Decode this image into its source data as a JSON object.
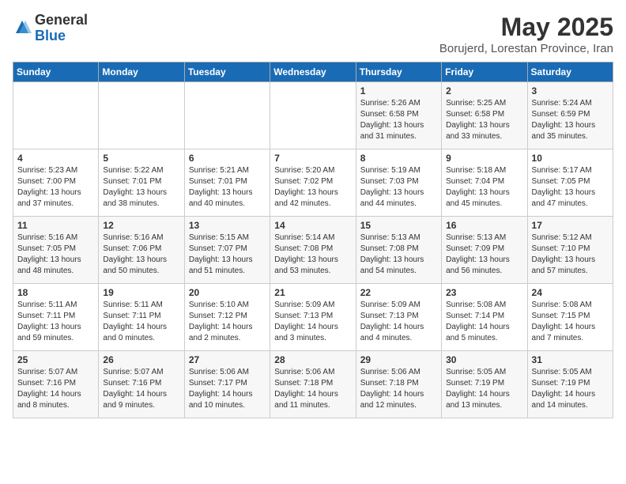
{
  "logo": {
    "general": "General",
    "blue": "Blue"
  },
  "title": {
    "month_year": "May 2025",
    "location": "Borujerd, Lorestan Province, Iran"
  },
  "days_of_week": [
    "Sunday",
    "Monday",
    "Tuesday",
    "Wednesday",
    "Thursday",
    "Friday",
    "Saturday"
  ],
  "weeks": [
    [
      {
        "day": "",
        "info": ""
      },
      {
        "day": "",
        "info": ""
      },
      {
        "day": "",
        "info": ""
      },
      {
        "day": "",
        "info": ""
      },
      {
        "day": "1",
        "info": "Sunrise: 5:26 AM\nSunset: 6:58 PM\nDaylight: 13 hours\nand 31 minutes."
      },
      {
        "day": "2",
        "info": "Sunrise: 5:25 AM\nSunset: 6:58 PM\nDaylight: 13 hours\nand 33 minutes."
      },
      {
        "day": "3",
        "info": "Sunrise: 5:24 AM\nSunset: 6:59 PM\nDaylight: 13 hours\nand 35 minutes."
      }
    ],
    [
      {
        "day": "4",
        "info": "Sunrise: 5:23 AM\nSunset: 7:00 PM\nDaylight: 13 hours\nand 37 minutes."
      },
      {
        "day": "5",
        "info": "Sunrise: 5:22 AM\nSunset: 7:01 PM\nDaylight: 13 hours\nand 38 minutes."
      },
      {
        "day": "6",
        "info": "Sunrise: 5:21 AM\nSunset: 7:01 PM\nDaylight: 13 hours\nand 40 minutes."
      },
      {
        "day": "7",
        "info": "Sunrise: 5:20 AM\nSunset: 7:02 PM\nDaylight: 13 hours\nand 42 minutes."
      },
      {
        "day": "8",
        "info": "Sunrise: 5:19 AM\nSunset: 7:03 PM\nDaylight: 13 hours\nand 44 minutes."
      },
      {
        "day": "9",
        "info": "Sunrise: 5:18 AM\nSunset: 7:04 PM\nDaylight: 13 hours\nand 45 minutes."
      },
      {
        "day": "10",
        "info": "Sunrise: 5:17 AM\nSunset: 7:05 PM\nDaylight: 13 hours\nand 47 minutes."
      }
    ],
    [
      {
        "day": "11",
        "info": "Sunrise: 5:16 AM\nSunset: 7:05 PM\nDaylight: 13 hours\nand 48 minutes."
      },
      {
        "day": "12",
        "info": "Sunrise: 5:16 AM\nSunset: 7:06 PM\nDaylight: 13 hours\nand 50 minutes."
      },
      {
        "day": "13",
        "info": "Sunrise: 5:15 AM\nSunset: 7:07 PM\nDaylight: 13 hours\nand 51 minutes."
      },
      {
        "day": "14",
        "info": "Sunrise: 5:14 AM\nSunset: 7:08 PM\nDaylight: 13 hours\nand 53 minutes."
      },
      {
        "day": "15",
        "info": "Sunrise: 5:13 AM\nSunset: 7:08 PM\nDaylight: 13 hours\nand 54 minutes."
      },
      {
        "day": "16",
        "info": "Sunrise: 5:13 AM\nSunset: 7:09 PM\nDaylight: 13 hours\nand 56 minutes."
      },
      {
        "day": "17",
        "info": "Sunrise: 5:12 AM\nSunset: 7:10 PM\nDaylight: 13 hours\nand 57 minutes."
      }
    ],
    [
      {
        "day": "18",
        "info": "Sunrise: 5:11 AM\nSunset: 7:11 PM\nDaylight: 13 hours\nand 59 minutes."
      },
      {
        "day": "19",
        "info": "Sunrise: 5:11 AM\nSunset: 7:11 PM\nDaylight: 14 hours\nand 0 minutes."
      },
      {
        "day": "20",
        "info": "Sunrise: 5:10 AM\nSunset: 7:12 PM\nDaylight: 14 hours\nand 2 minutes."
      },
      {
        "day": "21",
        "info": "Sunrise: 5:09 AM\nSunset: 7:13 PM\nDaylight: 14 hours\nand 3 minutes."
      },
      {
        "day": "22",
        "info": "Sunrise: 5:09 AM\nSunset: 7:13 PM\nDaylight: 14 hours\nand 4 minutes."
      },
      {
        "day": "23",
        "info": "Sunrise: 5:08 AM\nSunset: 7:14 PM\nDaylight: 14 hours\nand 5 minutes."
      },
      {
        "day": "24",
        "info": "Sunrise: 5:08 AM\nSunset: 7:15 PM\nDaylight: 14 hours\nand 7 minutes."
      }
    ],
    [
      {
        "day": "25",
        "info": "Sunrise: 5:07 AM\nSunset: 7:16 PM\nDaylight: 14 hours\nand 8 minutes."
      },
      {
        "day": "26",
        "info": "Sunrise: 5:07 AM\nSunset: 7:16 PM\nDaylight: 14 hours\nand 9 minutes."
      },
      {
        "day": "27",
        "info": "Sunrise: 5:06 AM\nSunset: 7:17 PM\nDaylight: 14 hours\nand 10 minutes."
      },
      {
        "day": "28",
        "info": "Sunrise: 5:06 AM\nSunset: 7:18 PM\nDaylight: 14 hours\nand 11 minutes."
      },
      {
        "day": "29",
        "info": "Sunrise: 5:06 AM\nSunset: 7:18 PM\nDaylight: 14 hours\nand 12 minutes."
      },
      {
        "day": "30",
        "info": "Sunrise: 5:05 AM\nSunset: 7:19 PM\nDaylight: 14 hours\nand 13 minutes."
      },
      {
        "day": "31",
        "info": "Sunrise: 5:05 AM\nSunset: 7:19 PM\nDaylight: 14 hours\nand 14 minutes."
      }
    ]
  ]
}
